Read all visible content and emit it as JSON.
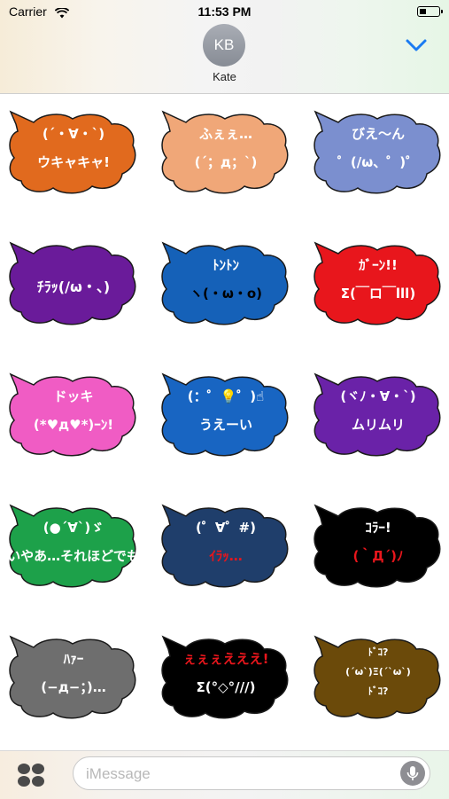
{
  "status": {
    "carrier": "Carrier",
    "time": "11:53 PM"
  },
  "contact": {
    "initials": "KB",
    "name": "Kate"
  },
  "composer": {
    "placeholder": "iMessage"
  },
  "colors": {
    "accent": "#1a7bf2"
  },
  "icons": [
    "wifi-icon",
    "battery-icon",
    "chevron-down-icon",
    "apps-icon",
    "mic-icon"
  ],
  "stickers": [
    {
      "color": "#e16a1e",
      "lines": [
        {
          "text": "(´・∀・`)",
          "color": "#ffffff"
        },
        {
          "text": "ウキャキャ!",
          "color": "#ffffff"
        }
      ]
    },
    {
      "color": "#f0a778",
      "lines": [
        {
          "text": "ふぇぇ…",
          "color": "#ffffff"
        },
        {
          "text": "(´；д；`)",
          "color": "#ffffff"
        }
      ]
    },
    {
      "color": "#7b8fcf",
      "lines": [
        {
          "text": "びえ～ん",
          "color": "#ffffff"
        },
        {
          "text": "゜(/ω、゜)゜",
          "color": "#ffffff"
        }
      ]
    },
    {
      "color": "#6a1b9a",
      "lines": [
        {
          "text": "ﾁﾗｯ(/ω・、)",
          "color": "#ffffff"
        }
      ]
    },
    {
      "color": "#1561b8",
      "lines": [
        {
          "text": "ﾄﾝﾄﾝ",
          "color": "#ffffff"
        },
        {
          "text": "ヽ(・ω・o)",
          "color": "#000000"
        }
      ]
    },
    {
      "color": "#e8161c",
      "lines": [
        {
          "text": "ｶﾞｰﾝ!!",
          "color": "#ffffff"
        },
        {
          "text": "Σ(￣ロ￣lll)",
          "color": "#ffffff"
        }
      ]
    },
    {
      "color": "#f05cc4",
      "lines": [
        {
          "text": "ドッキ",
          "color": "#ffffff"
        },
        {
          "text": "(*♥д♥*)ｰﾝ!",
          "color": "#ffffff"
        }
      ]
    },
    {
      "color": "#1865c2",
      "lines": [
        {
          "text": "(：゜💡゜)☝",
          "color": "#ffffff"
        },
        {
          "text": "うえーい",
          "color": "#ffffff"
        }
      ]
    },
    {
      "color": "#6a22a8",
      "lines": [
        {
          "text": "(ヾﾉ・∀・`)",
          "color": "#ffffff"
        },
        {
          "text": "ムリムリ",
          "color": "#ffffff"
        }
      ]
    },
    {
      "color": "#1da14a",
      "lines": [
        {
          "text": "(●´∀`)ゞ",
          "color": "#ffffff"
        },
        {
          "text": "いやあ…それほどでも",
          "color": "#ffffff"
        }
      ]
    },
    {
      "color": "#1f3e6b",
      "lines": [
        {
          "text": "(゜∀゜#)",
          "color": "#ffffff"
        },
        {
          "text": "ｲﾗｯ…",
          "color": "#e8161c"
        }
      ]
    },
    {
      "color": "#000000",
      "lines": [
        {
          "text": "ｺﾗｰ!",
          "color": "#ffffff"
        },
        {
          "text": "(｀Д´)ﾉ",
          "color": "#e8161c"
        }
      ]
    },
    {
      "color": "#6e6e6e",
      "lines": [
        {
          "text": "ﾊｧｰ",
          "color": "#ffffff"
        },
        {
          "text": "(−д−；)…",
          "color": "#ffffff"
        }
      ]
    },
    {
      "color": "#000000",
      "lines": [
        {
          "text": "ぇぇぇえええ!",
          "color": "#e8161c"
        },
        {
          "text": "Σ(°◇°///)",
          "color": "#ffffff"
        }
      ]
    },
    {
      "color": "#6b4a0a",
      "lines": [
        {
          "text": "ﾄﾞｺ?",
          "color": "#ffffff"
        },
        {
          "text": "(´ω`)Ξ(´`ω`)",
          "color": "#ffffff"
        },
        {
          "text": "ﾄﾞｺ?",
          "color": "#ffffff"
        }
      ]
    }
  ]
}
